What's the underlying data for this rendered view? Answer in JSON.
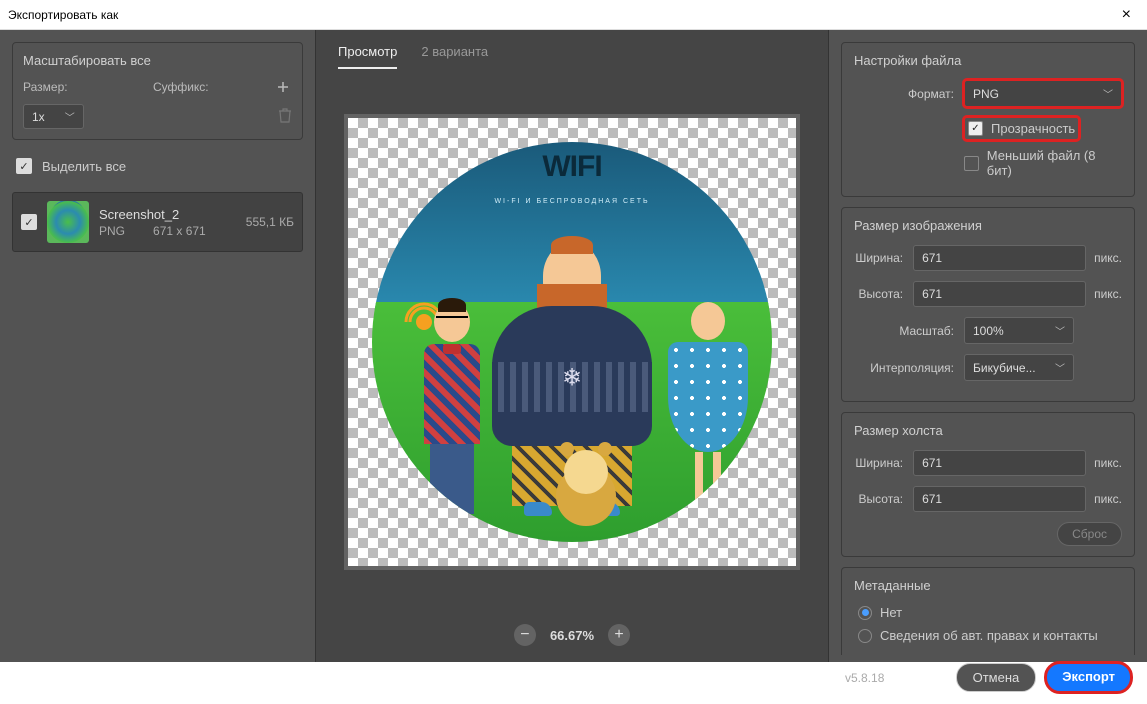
{
  "titlebar": {
    "title": "Экспортировать как"
  },
  "left": {
    "scale_all": "Масштабировать все",
    "size_label": "Размер:",
    "suffix_label": "Суффикс:",
    "size_value": "1x",
    "select_all": "Выделить все",
    "file": {
      "name": "Screenshot_2",
      "format": "PNG",
      "dimensions": "671 x 671",
      "size": "555,1 КБ"
    }
  },
  "center": {
    "tab_preview": "Просмотр",
    "tab_variants": "2 варианта",
    "logo": "WIFI",
    "logo_sub": "WI-FI И БЕСПРОВОДНАЯ СЕТЬ",
    "zoom": "66.67%"
  },
  "right": {
    "file_settings": "Настройки файла",
    "format_label": "Формат:",
    "format_value": "PNG",
    "transparency": "Прозрачность",
    "smaller_file": "Меньший файл (8 бит)",
    "image_size": "Размер изображения",
    "width_label": "Ширина:",
    "height_label": "Высота:",
    "width_value": "671",
    "height_value": "671",
    "px": "пикс.",
    "scale_label": "Масштаб:",
    "scale_value": "100%",
    "resample_label": "Интерполяция:",
    "resample_value": "Бикубиче...",
    "canvas_size": "Размер холста",
    "canvas_width": "671",
    "canvas_height": "671",
    "reset": "Сброс",
    "metadata": "Метаданные",
    "meta_none": "Нет",
    "meta_info": "Сведения об авт. правах и контакты",
    "version": "v5.8.18",
    "cancel": "Отмена",
    "export": "Экспорт"
  }
}
